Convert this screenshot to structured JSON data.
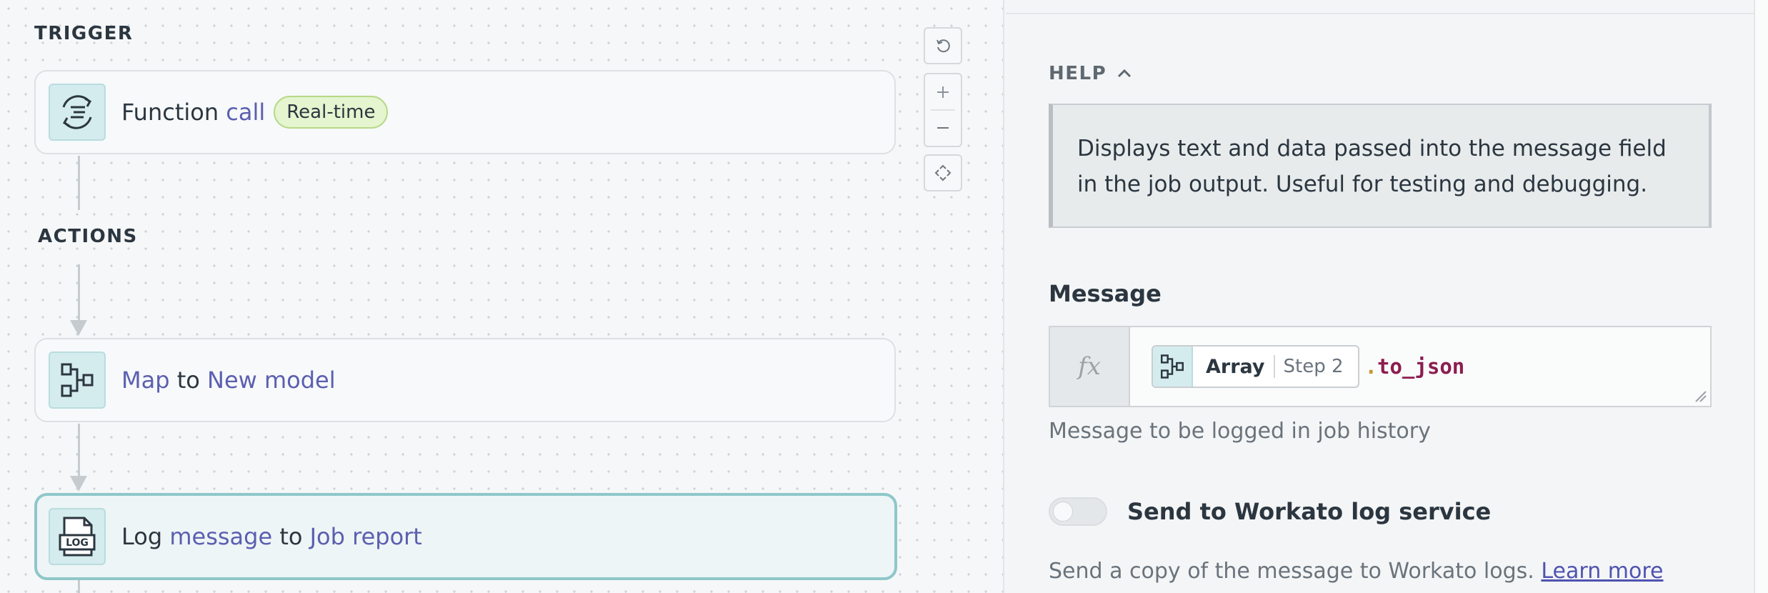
{
  "canvas": {
    "trigger_label": "TRIGGER",
    "actions_label": "ACTIONS",
    "steps": [
      {
        "icon": "function-call-icon",
        "parts": [
          "Function",
          "call"
        ],
        "badge": "Real-time"
      },
      {
        "icon": "map-icon",
        "parts": [
          "Map",
          "to",
          "New model"
        ]
      },
      {
        "icon": "log-file-icon",
        "icon_text": "LOG",
        "parts": [
          "Log",
          "message",
          "to",
          "Job report"
        ]
      }
    ],
    "controls": {
      "reset_icon": "reset-icon",
      "zoom_in_icon": "plus-icon",
      "zoom_out_icon": "minus-icon",
      "fit_icon": "fit-view-icon"
    }
  },
  "panel": {
    "help_title": "HELP",
    "help_text": "Displays text and data passed into the message field in the job output. Useful for testing and debugging.",
    "message_label": "Message",
    "formula": {
      "fx_label": "fx",
      "pill_name": "Array",
      "pill_step": "Step 2",
      "method_dot": ".",
      "method_name": "to_json"
    },
    "message_hint": "Message to be logged in job history",
    "toggle_label": "Send to Workato log service",
    "toggle_on": false,
    "description": "Send a copy of the message to Workato logs.",
    "learn_more": "Learn more"
  },
  "colors": {
    "accent": "#5b5fb0",
    "active_border": "#8ec7ca",
    "badge_bg": "#e4f5cf",
    "method": "#8b1d4f"
  }
}
